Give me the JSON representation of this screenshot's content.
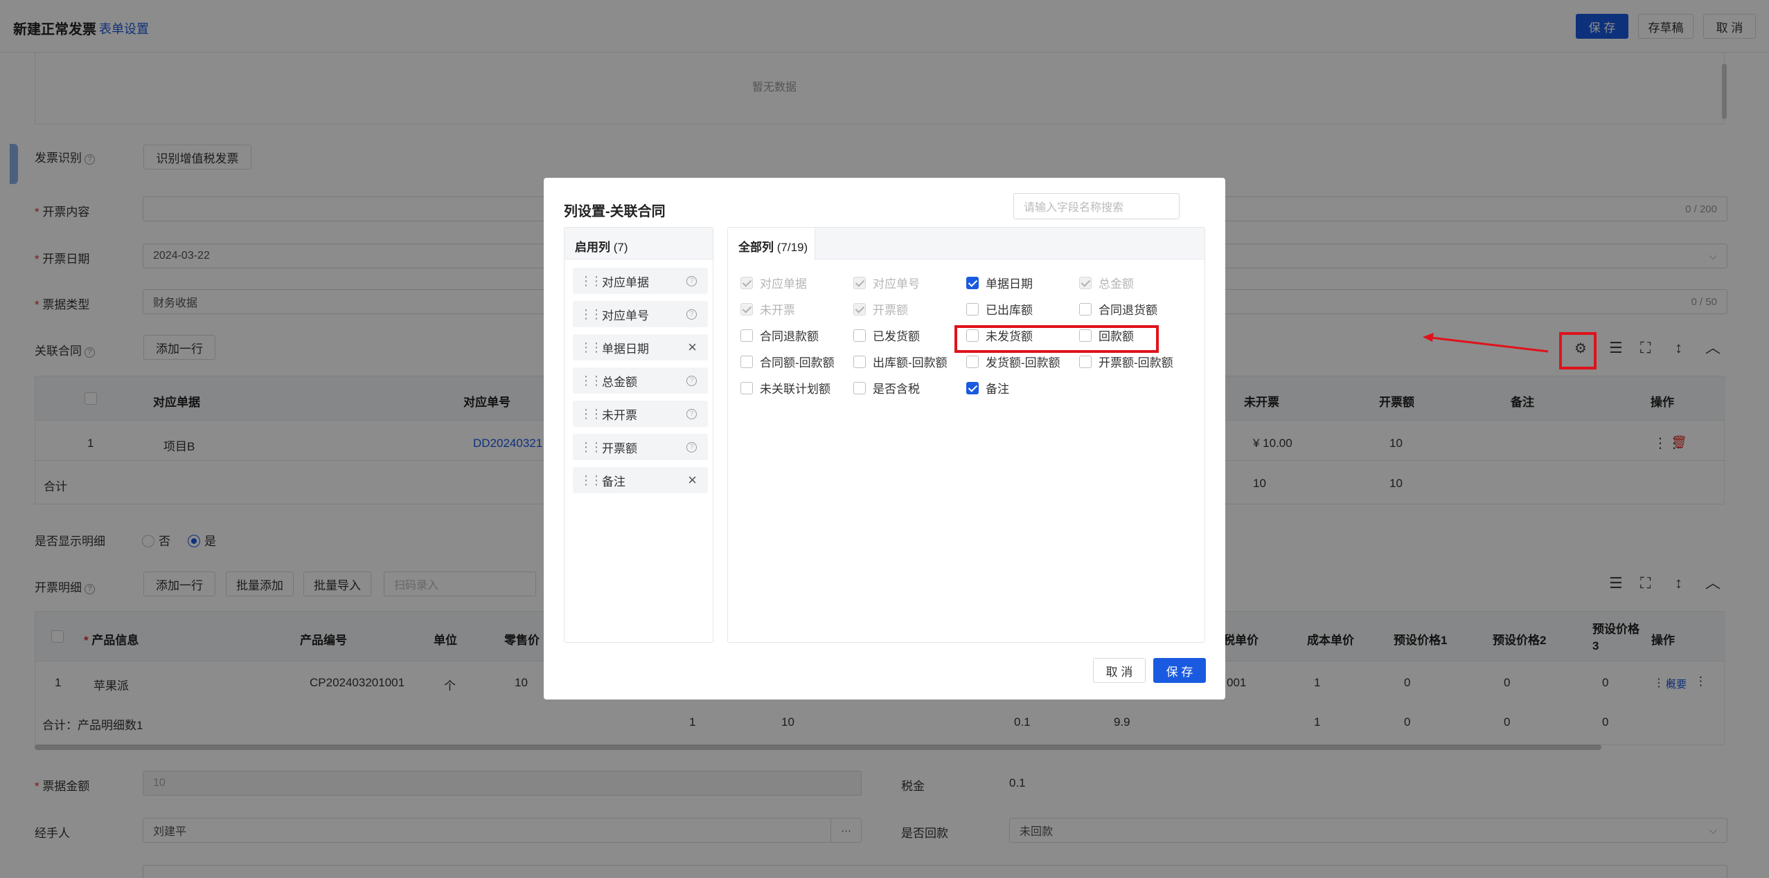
{
  "header": {
    "title": "新建正常发票",
    "form_settings_link": "表单设置",
    "save_label": "保 存",
    "draft_label": "存草稿",
    "cancel_label": "取 消"
  },
  "empty_text": "暂无数据",
  "form": {
    "invoice_recognition_label": "发票识别",
    "recognize_button": "识别增值税发票",
    "content_label": "开票内容",
    "content_counter": "0 / 200",
    "date_label": "开票日期",
    "date_value": "2024-03-22",
    "receipt_type_label": "票据类型",
    "receipt_type_value": "财务收据",
    "receipt_type_counter": "0 / 50",
    "related_contract_label": "关联合同",
    "add_row_button": "添加一行"
  },
  "contract_table": {
    "headers": [
      "对应单据",
      "对应单号",
      "未开票",
      "开票额",
      "备注",
      "操作"
    ],
    "row": {
      "index": "1",
      "doc": "项目B",
      "number": "DD20240321",
      "unbilled": "¥ 10.00",
      "billed": "10"
    },
    "total_label": "合计",
    "total_unbilled": "10",
    "total_billed": "10"
  },
  "show_detail": {
    "label": "是否显示明细",
    "option_no": "否",
    "option_yes": "是",
    "selected": "是"
  },
  "detail": {
    "label": "开票明细",
    "add_row": "添加一行",
    "batch_add": "批量添加",
    "batch_import": "批量导入",
    "scan_placeholder": "扫码录入",
    "headers": [
      "产品信息",
      "产品编号",
      "单位",
      "零售价",
      "税单价",
      "成本单价",
      "预设价格1",
      "预设价格2",
      "预设价格3",
      "操作"
    ],
    "row": {
      "index": "1",
      "product": "苹果派",
      "code": "CP202403201001",
      "unit": "个",
      "retail": "10",
      "tax_unit_price": "001",
      "cost": "1",
      "p1": "0",
      "p2": "0",
      "p3": "0",
      "action": "概要"
    },
    "total": {
      "label": "合计：产品明细数1",
      "c1": "1",
      "c2": "10",
      "c3": "0.1",
      "c4": "9.9",
      "c5": "1",
      "c6": "0",
      "c7": "0",
      "c8": "0"
    }
  },
  "footer_form": {
    "amount_label": "票据金额",
    "amount_value": "10",
    "tax_label": "税金",
    "tax_value": "0.1",
    "handler_label": "经手人",
    "handler_value": "刘建平",
    "paid_label": "是否回款",
    "paid_value": "未回款"
  },
  "modal": {
    "title": "列设置-关联合同",
    "search_placeholder": "请输入字段名称搜索",
    "enabled_tab": "启用列",
    "enabled_count": "(7)",
    "all_tab": "全部列",
    "all_count": "(7/19)",
    "enabled_items": [
      {
        "label": "对应单据",
        "removable": false
      },
      {
        "label": "对应单号",
        "removable": false
      },
      {
        "label": "单据日期",
        "removable": true
      },
      {
        "label": "总金额",
        "removable": false
      },
      {
        "label": "未开票",
        "removable": false
      },
      {
        "label": "开票额",
        "removable": false
      },
      {
        "label": "备注",
        "removable": true
      }
    ],
    "all_items": [
      {
        "label": "对应单据",
        "state": "disabled"
      },
      {
        "label": "对应单号",
        "state": "disabled"
      },
      {
        "label": "单据日期",
        "state": "checked"
      },
      {
        "label": "总金额",
        "state": "disabled"
      },
      {
        "label": "未开票",
        "state": "disabled"
      },
      {
        "label": "开票额",
        "state": "disabled"
      },
      {
        "label": "已出库额",
        "state": "unchecked"
      },
      {
        "label": "合同退货额",
        "state": "unchecked"
      },
      {
        "label": "合同退款额",
        "state": "unchecked"
      },
      {
        "label": "已发货额",
        "state": "unchecked"
      },
      {
        "label": "未发货额",
        "state": "unchecked"
      },
      {
        "label": "回款额",
        "state": "unchecked"
      },
      {
        "label": "合同额-回款额",
        "state": "unchecked"
      },
      {
        "label": "出库额-回款额",
        "state": "unchecked"
      },
      {
        "label": "发货额-回款额",
        "state": "unchecked"
      },
      {
        "label": "开票额-回款额",
        "state": "unchecked"
      },
      {
        "label": "未关联计划额",
        "state": "unchecked"
      },
      {
        "label": "是否含税",
        "state": "unchecked"
      },
      {
        "label": "备注",
        "state": "checked"
      }
    ],
    "cancel_label": "取 消",
    "save_label": "保 存"
  },
  "colors": {
    "primary": "#1a5ae0",
    "highlight": "#e0121b",
    "required": "#e0312b"
  }
}
